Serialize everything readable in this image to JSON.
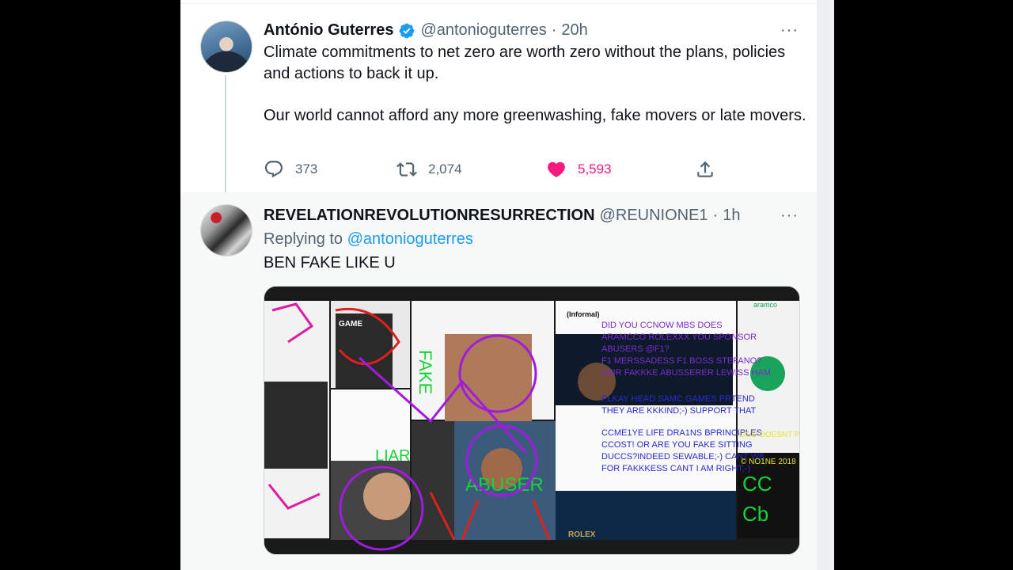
{
  "main_tweet": {
    "name": "António Guterres",
    "handle": "@antonioguterres",
    "separator": "·",
    "time": "20h",
    "more": "···",
    "paragraphs": [
      "Climate commitments to net zero are worth zero without the plans, policies and actions to back it up.",
      "Our world cannot afford any more greenwashing, fake movers or late movers."
    ],
    "replies": "373",
    "retweets": "2,074",
    "likes": "5,593",
    "verified_icon": "verified-badge-icon",
    "colors": {
      "like": "#f91880",
      "verified": "#1d9bf0",
      "muted": "#536471"
    }
  },
  "reply_tweet": {
    "name": "REVELATIONREVOLUTIONRESURRECTION",
    "handle": "@REUNIONE1",
    "separator": "·",
    "time": "1h",
    "more": "···",
    "replying_prefix": "Replying to",
    "replying_mention": "@antonioguterres",
    "text": "BEN FAKE LIKE U",
    "media": {
      "collage_texts": {
        "abuser": "ABUSER",
        "liar": "LIAR",
        "informal": "(Informal)",
        "aramco": "aramco",
        "rolex": "ROLEX",
        "did_you": "DID YOU CCNOW MBS DOES",
        "aramcco": "ARAMCCO ROLEXXX YOU SPONSOR",
        "abusers": "ABUSERS @F1?",
        "f1": "F1 MERSSADESS F1 BOSS STEFANO?",
        "ssir": "SSIR FAKKKE ABUSSERER LEWISS HAM",
        "plkay": "PLKAY HEAD SAMC GAMES PRTEND",
        "they": "THEY ARE KKKIND;-) SUPPORT THAT",
        "ccme": "CCME1YE LIFE DRA1NS BPRINCIPLES",
        "ccost": "CCOST! OR ARE YOU FAKE SITTING",
        "duccs": "DUCCS?INDEED SEWABLE;-) CANT W8",
        "for_fak": "FOR FAKKKESS CANT I AM RIGHT;-)",
        "god": "GOD DOESNT PLAY DIC",
        "no1ne": "© NO1NE 2018",
        "cc": "CC",
        "cb": "Cb",
        "fake": "FAKE",
        "game": "GAME"
      }
    }
  }
}
